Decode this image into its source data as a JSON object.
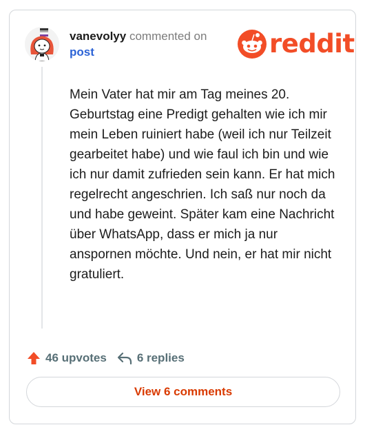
{
  "comment": {
    "username": "vanevolyy",
    "action_text": "commented on",
    "target_link": "post",
    "body": "Mein Vater hat mir am Tag meines 20. Geburtstag eine Predigt gehalten wie ich mir mein Leben ruiniert habe (weil ich nur Teilzeit gearbeitet habe) und wie faul ich bin und wie ich nur damit zufrieden sein kann. Er hat mich regelrecht angeschrien. Ich saß nur noch da und habe geweint. Später kam eine Nachricht über WhatsApp, dass er mich ja nur anspornen möchte. Und nein, er hat mir nicht gratuliert."
  },
  "brand": {
    "logo_text": "reddit",
    "logo_icon": "reddit-snoo-icon",
    "color": "#f24d27"
  },
  "footer": {
    "upvotes_label": "46 upvotes",
    "upvote_icon": "upvote-arrow-icon",
    "upvote_color": "#f24d27",
    "replies_label": "6 replies",
    "reply_icon": "reply-arrow-icon",
    "view_comments_label": "View 6 comments",
    "view_comments_color": "#d93a00"
  }
}
